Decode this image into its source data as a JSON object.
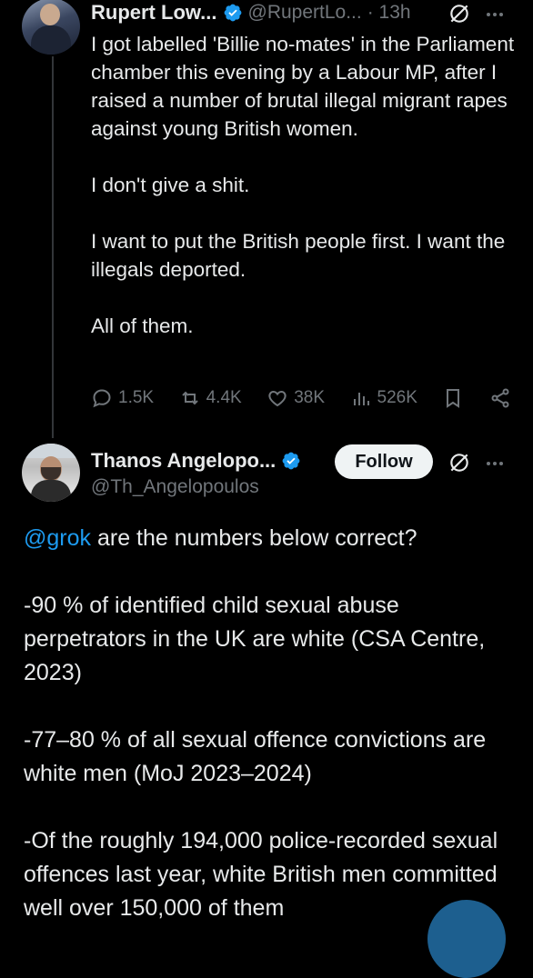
{
  "tweet1": {
    "display_name": "Rupert Low...",
    "handle": "@RupertLo...",
    "time": "· 13h",
    "body": "I got labelled 'Billie no-mates' in the Parliament chamber this evening by a Labour MP, after I raised a number of brutal illegal migrant rapes against young British women.\n\nI don't give a shit.\n\nI want to put the British people first. I want the illegals deported.\n\nAll of them.",
    "actions": {
      "replies": "1.5K",
      "reposts": "4.4K",
      "likes": "38K",
      "views": "526K"
    }
  },
  "tweet2": {
    "display_name": "Thanos Angelopo...",
    "handle": "@Th_Angelopoulos",
    "follow_label": "Follow",
    "mention": "@grok",
    "body_first_line": " are the numbers below correct?",
    "body_rest": "-90 % of identified child sexual abuse perpetrators in the UK are white (CSA Centre, 2023)\n\n-77–80 % of all sexual offence convictions are white men (MoJ 2023–2024)\n\n-Of the roughly 194,000 police-recorded sexual offences last year, white British men committed well over 150,000 of them"
  },
  "colors": {
    "background": "#000000",
    "text": "#e7e9ea",
    "muted": "#71767b",
    "accent": "#1d9bf0",
    "verified": "#1d9bf0"
  },
  "icons": [
    "verified-badge-icon",
    "grok-icon",
    "more-icon",
    "reply-icon",
    "repost-icon",
    "like-icon",
    "views-icon",
    "bookmark-icon",
    "share-icon"
  ]
}
